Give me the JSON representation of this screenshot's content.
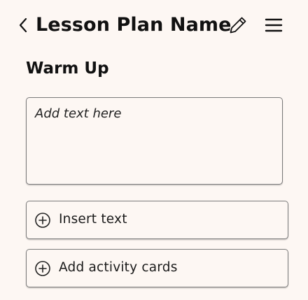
{
  "header": {
    "title": "Lesson Plan Name",
    "back_icon": "chevron-left-icon",
    "edit_icon": "pencil-icon",
    "menu_icon": "hamburger-menu-icon"
  },
  "section": {
    "title": "Warm Up"
  },
  "editor": {
    "value": "",
    "placeholder": "Add text here"
  },
  "actions": [
    {
      "label": "Insert text",
      "icon": "plus-circle-icon"
    },
    {
      "label": "Add activity cards",
      "icon": "plus-circle-icon"
    }
  ],
  "colors": {
    "background": "#fdf7f3",
    "text": "#111111",
    "border": "#7a7a7a"
  }
}
